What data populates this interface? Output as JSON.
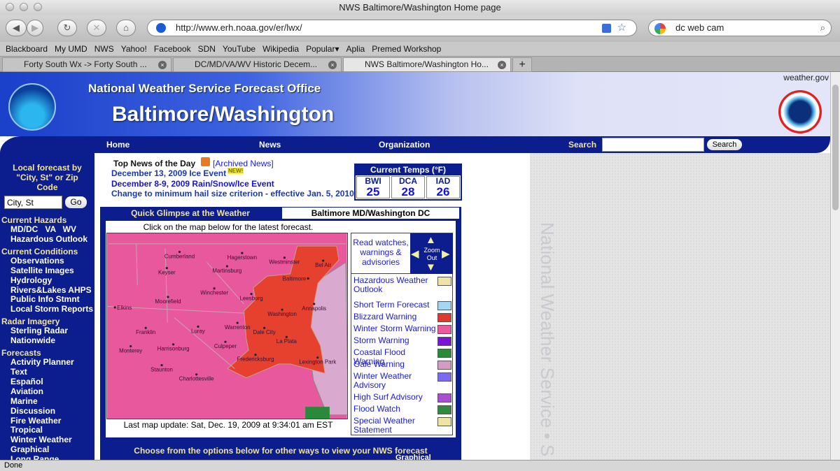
{
  "window": {
    "title": "NWS Baltimore/Washington Home page"
  },
  "toolbar": {
    "url": "http://www.erh.noaa.gov/er/lwx/",
    "search_value": "dc web cam"
  },
  "bookmarks": [
    "Blackboard",
    "My UMD",
    "NWS",
    "Yahoo!",
    "Facebook",
    "SDN",
    "YouTube",
    "Wikipedia",
    "Popular",
    "Aplia",
    "Premed Workshop"
  ],
  "tabs": [
    {
      "label": "Forty South Wx -> Forty South ..."
    },
    {
      "label": "DC/MD/VA/WV Historic Decem..."
    },
    {
      "label": "NWS Baltimore/Washington Ho..."
    }
  ],
  "header": {
    "org": "National Weather Service Forecast Office",
    "office": "Baltimore/Washington",
    "weather_gov": "weather.gov",
    "noaa_logo": "NOAA",
    "nws_logo": "NATIONAL WEATHER SERVICE"
  },
  "nav": {
    "home": "Home",
    "news": "News",
    "organization": "Organization",
    "search_label": "Search",
    "search_button": "Search"
  },
  "sidebar": {
    "local_label": "Local forecast by \"City, St\" or Zip Code",
    "city_placeholder": "City, St",
    "go": "Go",
    "sections": [
      {
        "title": "Current Hazards",
        "items": [
          "MD/DC   VA   WV",
          "Hazardous Outlook"
        ]
      },
      {
        "title": "Current Conditions",
        "items": [
          "Observations",
          "Satellite Images",
          "Hydrology",
          "Rivers&Lakes AHPS",
          "Public Info Stmnt",
          "Local Storm Reports"
        ]
      },
      {
        "title": "Radar Imagery",
        "items": [
          "Sterling Radar",
          "Nationwide"
        ]
      },
      {
        "title": "Forecasts",
        "items": [
          "Activity Planner",
          "Text",
          "Español",
          "Aviation",
          "Marine",
          "Discussion",
          "Fire Weather",
          "Tropical",
          "Winter Weather",
          "Graphical",
          "Long Range"
        ]
      }
    ]
  },
  "news": {
    "title": "Top News of the Day",
    "archived": "[Archived News]",
    "new_badge": "NEW!",
    "items": [
      "December 13, 2009 Ice Event",
      "December 8-9, 2009 Rain/Snow/Ice Event",
      "Change to minimum hail size criterion - effective Jan. 5, 2010"
    ]
  },
  "temps": {
    "title": "Current Temps (°F)",
    "stations": [
      {
        "code": "BWI",
        "temp": "25"
      },
      {
        "code": "DCA",
        "temp": "28"
      },
      {
        "code": "IAD",
        "temp": "26"
      }
    ]
  },
  "glimpse": {
    "title": "Quick Glimpse at the Weather",
    "location": "Baltimore MD/Washington DC",
    "instruction": "Click on the map below for the latest forecast.",
    "last_update": "Last map update: Sat, Dec. 19, 2009 at 9:34:01 am EST",
    "read_watches": "Read watches, warnings & advisories",
    "zoom_out": "Zoom Out",
    "bottom_text": "Choose from the options below for other ways to view your NWS forecast",
    "bottom_partial": "Graphical"
  },
  "map": {
    "cities": [
      "Cumberland",
      "Keyser",
      "Hagerstown",
      "Martinsburg",
      "Westminster",
      "Bel Air",
      "Baltimore",
      "Winchester",
      "Leesburg",
      "Moorefield",
      "Elkins",
      "Annapolis",
      "Washington",
      "Warrenton",
      "Luray",
      "Franklin",
      "Dale City",
      "La Plata",
      "Culpeper",
      "Harrisonburg",
      "Monterey",
      "Fredericksburg",
      "Lexington Park",
      "Staunton",
      "Charlottesville"
    ],
    "colors": {
      "winter_storm": "#e8589c",
      "blizzard": "#e6412f",
      "bay": "#d9a9cf"
    }
  },
  "legend": [
    {
      "label": "Hazardous Weather Outlook",
      "color": "#efe4a4"
    },
    {
      "label": "Short Term Forecast",
      "color": "#a3d7f5"
    },
    {
      "label": "Blizzard Warning",
      "color": "#e03a2c"
    },
    {
      "label": "Winter Storm Warning",
      "color": "#ea5a9f"
    },
    {
      "label": "Storm Warning",
      "color": "#7a14d8"
    },
    {
      "label": "Coastal Flood Warning",
      "color": "#2a8a3a"
    },
    {
      "label": "Gale Warning",
      "color": "#d59ac6"
    },
    {
      "label": "Winter Weather Advisory",
      "color": "#7a6cf0"
    },
    {
      "label": "High Surf Advisory",
      "color": "#a84fd0"
    },
    {
      "label": "Flood Watch",
      "color": "#2e8a3c"
    },
    {
      "label": "Special Weather Statement",
      "color": "#efe4a4"
    }
  ],
  "right_panel": {
    "vertical_text": "National Weather Service • S"
  },
  "status": {
    "text": "Done"
  }
}
